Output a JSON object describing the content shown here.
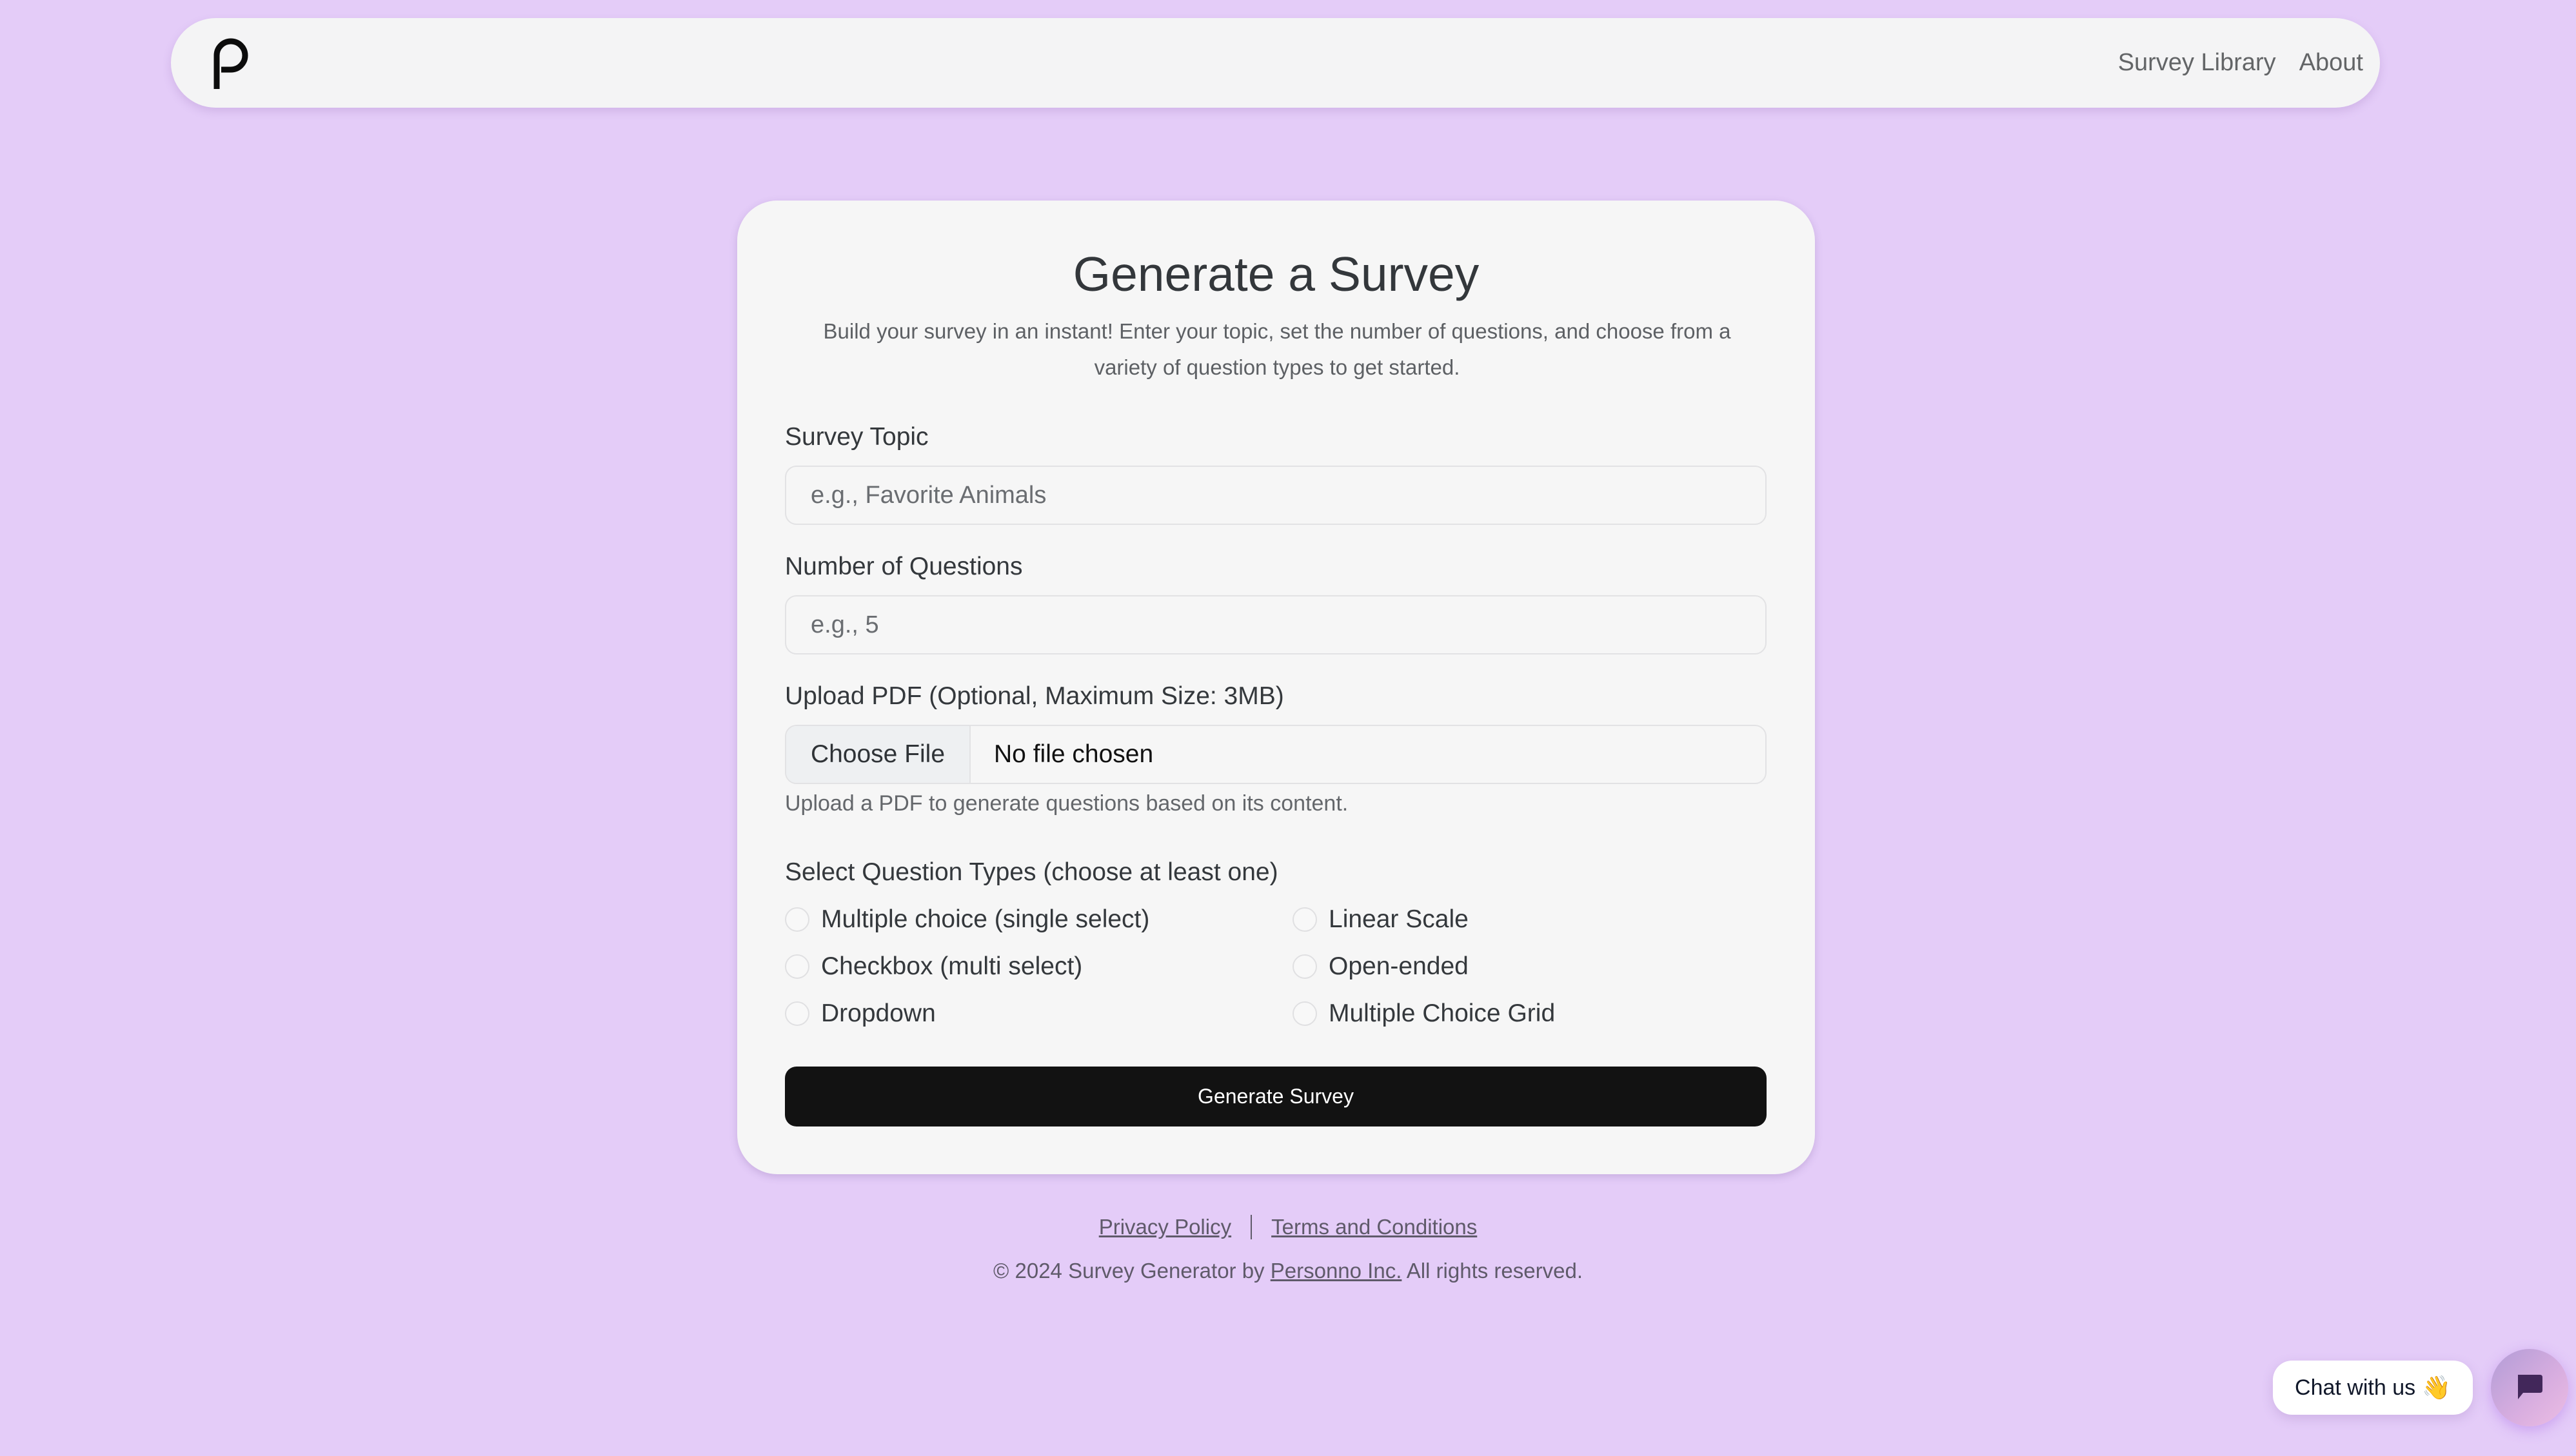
{
  "navbar": {
    "logo": "P",
    "links": [
      {
        "label": "Survey Library"
      },
      {
        "label": "About"
      }
    ]
  },
  "form": {
    "title": "Generate a Survey",
    "subtitle": "Build your survey in an instant! Enter your topic, set the number of questions, and choose from a variety of question types to get started.",
    "topic": {
      "label": "Survey Topic",
      "placeholder": "e.g., Favorite Animals",
      "value": ""
    },
    "num_questions": {
      "label": "Number of Questions",
      "placeholder": "e.g., 5",
      "value": ""
    },
    "upload": {
      "label": "Upload PDF (Optional, Maximum Size: 3MB)",
      "button_label": "Choose File",
      "status": "No file chosen",
      "hint": "Upload a PDF to generate questions based on its content."
    },
    "question_types": {
      "label": "Select Question Types (choose at least one)",
      "options": [
        {
          "label": "Multiple choice (single select)",
          "checked": false
        },
        {
          "label": "Checkbox (multi select)",
          "checked": false
        },
        {
          "label": "Dropdown",
          "checked": false
        },
        {
          "label": "Linear Scale",
          "checked": false
        },
        {
          "label": "Open-ended",
          "checked": false
        },
        {
          "label": "Multiple Choice Grid",
          "checked": false
        }
      ]
    },
    "submit_label": "Generate Survey"
  },
  "footer": {
    "privacy_label": "Privacy Policy",
    "terms_label": "Terms and Conditions",
    "copyright_prefix": "© 2024 Survey Generator by",
    "company": "Personno Inc.",
    "copyright_suffix": "All rights reserved."
  },
  "chat": {
    "bubble_label": "Chat with us",
    "bubble_emoji": "👋",
    "launcher_icon": "chat-bubble-icon"
  },
  "colors": {
    "background": "#e4ccf8",
    "card": "#f6f6f6",
    "primary_button": "#121212",
    "chat_icon": "#42275a"
  }
}
